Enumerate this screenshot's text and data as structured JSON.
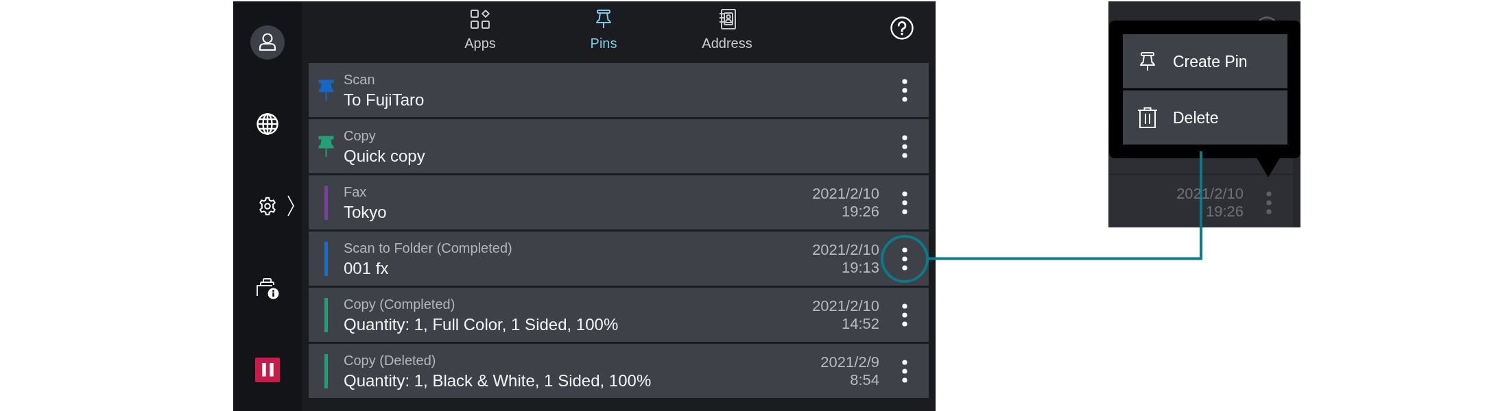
{
  "nav": {
    "tabs": [
      {
        "label": "Apps",
        "selected": false
      },
      {
        "label": "Pins",
        "selected": true
      },
      {
        "label": "Address",
        "selected": false
      }
    ]
  },
  "rows": [
    {
      "kind": "pinned",
      "color": "#1766c2",
      "category": "Scan",
      "title": "To FujiTaro",
      "callout": false
    },
    {
      "kind": "pinned",
      "color": "#23a079",
      "category": "Copy",
      "title": "Quick copy",
      "callout": false
    },
    {
      "kind": "history",
      "color": "#7b3f9e",
      "category": "Fax",
      "title": "Tokyo",
      "date": "2021/2/10",
      "time": "19:26",
      "callout": false
    },
    {
      "kind": "history",
      "color": "#1a70c6",
      "category": "Scan to Folder (Completed)",
      "title": "001 fx",
      "date": "2021/2/10",
      "time": "19:13",
      "callout": true
    },
    {
      "kind": "history",
      "color": "#21a073",
      "category": "Copy (Completed)",
      "title": "Quantity: 1, Full Color, 1 Sided, 100%",
      "date": "2021/2/10",
      "time": "14:52",
      "callout": false
    },
    {
      "kind": "history",
      "color": "#21a073",
      "category": "Copy (Deleted)",
      "title": "Quantity: 1, Black & White, 1 Sided, 100%",
      "date": "2021/2/9",
      "time": "8:54",
      "callout": false
    }
  ],
  "inset": {
    "row": {
      "date": "2021/2/10",
      "time": "19:26"
    },
    "menu": {
      "items": [
        {
          "label": "Create Pin"
        },
        {
          "label": "Delete"
        }
      ]
    }
  }
}
